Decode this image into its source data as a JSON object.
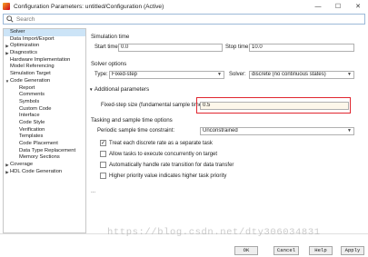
{
  "window": {
    "title": "Configuration Parameters: untitled/Configuration (Active)",
    "minimize_icon": "minimize-icon",
    "maximize_icon": "maximize-icon",
    "close_icon": "close-icon"
  },
  "search": {
    "placeholder": "Search"
  },
  "tree": [
    {
      "label": "Solver",
      "level": 0,
      "selected": true
    },
    {
      "label": "Data Import/Export",
      "level": 0
    },
    {
      "label": "Optimization",
      "level": 0,
      "expandable": true
    },
    {
      "label": "Diagnostics",
      "level": 0,
      "expandable": true
    },
    {
      "label": "Hardware Implementation",
      "level": 0
    },
    {
      "label": "Model Referencing",
      "level": 0
    },
    {
      "label": "Simulation Target",
      "level": 0
    },
    {
      "label": "Code Generation",
      "level": 0,
      "expanded": true
    },
    {
      "label": "Report",
      "level": 1
    },
    {
      "label": "Comments",
      "level": 1
    },
    {
      "label": "Symbols",
      "level": 1
    },
    {
      "label": "Custom Code",
      "level": 1
    },
    {
      "label": "Interface",
      "level": 1
    },
    {
      "label": "Code Style",
      "level": 1
    },
    {
      "label": "Verification",
      "level": 1
    },
    {
      "label": "Templates",
      "level": 1
    },
    {
      "label": "Code Placement",
      "level": 1
    },
    {
      "label": "Data Type Replacement",
      "level": 1
    },
    {
      "label": "Memory Sections",
      "level": 1
    },
    {
      "label": "Coverage",
      "level": 0,
      "expandable": true
    },
    {
      "label": "HDL Code Generation",
      "level": 0,
      "expandable": true
    }
  ],
  "simulation_time": {
    "section": "Simulation time",
    "start_label": "Start time:",
    "start_value": "0.0",
    "stop_label": "Stop time:",
    "stop_value": "10.0"
  },
  "solver_options": {
    "section": "Solver options",
    "type_label": "Type:",
    "type_value": "Fixed-step",
    "solver_label": "Solver:",
    "solver_value": "discrete (no continuous states)"
  },
  "additional": {
    "section": "Additional parameters",
    "step_label": "Fixed-step size (fundamental sample time):",
    "step_value": "0.5"
  },
  "tasking": {
    "section": "Tasking and sample time options",
    "constraint_label": "Periodic sample time constraint:",
    "constraint_value": "Unconstrained",
    "checks": [
      {
        "label": "Treat each discrete rate as a separate task",
        "checked": true
      },
      {
        "label": "Allow tasks to execute concurrently on target",
        "checked": false
      },
      {
        "label": "Automatically handle rate transition for data transfer",
        "checked": false
      },
      {
        "label": "Higher priority value indicates higher task priority",
        "checked": false
      }
    ],
    "ellipsis": "..."
  },
  "footer": {
    "ok": "OK",
    "cancel": "Cancel",
    "help": "Help",
    "apply": "Apply"
  },
  "watermark": "https://blog.csdn.net/dty306034831",
  "colors": {
    "selection": "#cce4f7",
    "highlight_box": "#e0262f"
  }
}
